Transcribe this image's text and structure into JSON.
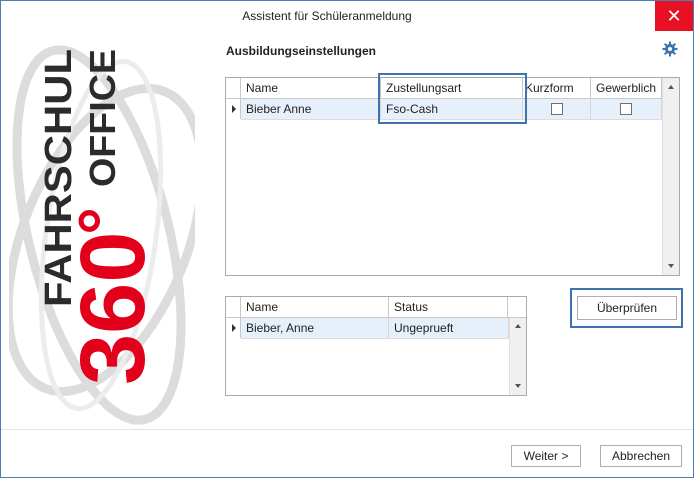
{
  "window": {
    "title": "Assistent für Schüleranmeldung",
    "close_glyph": "✕"
  },
  "logo": {
    "line1": "FAHRSCHUL",
    "number": "360",
    "degree": "°",
    "line2": "OFFICE",
    "red": "#e3001b",
    "dark": "#2b2b2b"
  },
  "section": {
    "title": "Ausbildungseinstellungen"
  },
  "grid1": {
    "columns": [
      "Name",
      "Zustellungsart",
      "Kurzform",
      "Gewerblich"
    ],
    "rows": [
      {
        "name": "Bieber Anne",
        "zustellungsart": "Fso-Cash",
        "kurzform": false,
        "gewerblich": false
      }
    ]
  },
  "grid2": {
    "columns": [
      "Name",
      "Status"
    ],
    "rows": [
      {
        "name": "Bieber, Anne",
        "status": "Ungeprueft"
      }
    ]
  },
  "buttons": {
    "check": "Überprüfen",
    "next": "Weiter >",
    "cancel": "Abbrechen"
  },
  "colors": {
    "accent": "#3f73b0",
    "close": "#e81123",
    "selected_row": "#e6f0fb"
  }
}
